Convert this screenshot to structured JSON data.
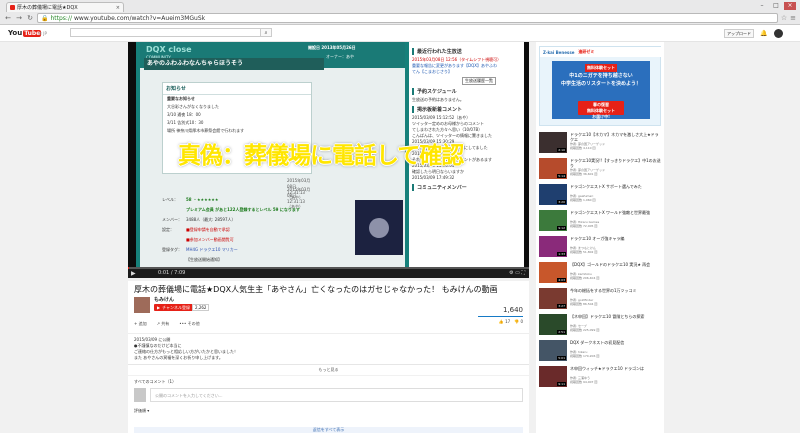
{
  "browser": {
    "tab_title": "厚木の葬儀場に電話★DQX",
    "tab_close": "×",
    "url_scheme": "https://",
    "url_rest": "www.youtube.com/watch?v=Aueim3MGuSk",
    "win_min": "–",
    "win_max": "□",
    "win_close": "×"
  },
  "youtube": {
    "logo_you": "You",
    "logo_tube": "Tube",
    "logo_jp": "JP",
    "upload_label": "アップロード"
  },
  "video": {
    "poster": {
      "brand": "DQX close",
      "brand_sub": "COMMUNITY",
      "date": "開設日 2013年05月26日",
      "owner": "オーナー：あや",
      "header_title": "あやのふわふわなんちゃらほうそう",
      "notice_heading": "お知らせ",
      "notice_title": "重要なお知らせ",
      "notice_lines": [
        "大谷彩さんがなくなりました",
        "3/10  通夜  18：00",
        "3/11  告別式10：30",
        "場所  神奈川県厚木市葬祭会館で行われます"
      ],
      "stamp1": "2015年03月08日 12:31:13（あや）",
      "stamp2": "2015年03月08日 12:31:13（あや）",
      "profile": [
        {
          "k": "レベル：",
          "v": "58 ・★★★★★★",
          "c": "hi"
        },
        {
          "k": "",
          "v": "プレミアム会員 があと122人登録するとレベル 59 になります",
          "c": "hi"
        },
        {
          "k": "メンバー：",
          "v": "3488人（最大: 28597人）",
          "c": ""
        },
        {
          "k": "設定：",
          "v": "■登録申請を自動で承認",
          "c": "red"
        },
        {
          "k": "",
          "v": "■参加メンバー動画閲覧可",
          "c": "red"
        },
        {
          "k": "登録タグ：",
          "v": "MH4G  ドラクエ10  マリカー",
          "c": "blue"
        },
        {
          "k": "",
          "v": "【生放送開始通知】",
          "c": ""
        }
      ],
      "panel": {
        "sec1": "最近行われた生放送",
        "live_date": "2015年03月08日 12:56（タイムシフト視聴可）",
        "live_title": "重要な報告に変更があります【DQX】あやふわ",
        "live_sub": "てん【こまおじさり】",
        "sec1_btn": "生放送履歴一覧",
        "sec2": "予約スケジュール",
        "sec2_text": "生放送の予約はありません。",
        "sec3": "掲示板新着コメント",
        "comments": [
          "2015/03/09 15:12:52（あや）",
          "ツイッター定めのお母様からのコメント",
          "てしまわされた方々へ思い（10/07B）",
          "こんばんは、ツイッターの情報に驚きました",
          "2015/03/09 15:30:29",
          "ごきおにぎりと生放送楽しみにしてました",
          "2015/03/09 15:47:51",
          "それぞれのアカウントでコメントがあるます",
          "2015/03/09 15:56:01",
          "確認したら明日ならいますか",
          "2015/03/09 17:49:32"
        ],
        "sec4": "コミュニティメンバー"
      }
    },
    "overlay": "真偽：葬儀場に電話して確認",
    "time": "0:01 / 7:09",
    "play_icon": "▶",
    "ctl_icons": "⚙  ▭  ⛶",
    "progress": 0.002
  },
  "info": {
    "title": "厚木の葬儀場に電話★DQX人気生主「あやさん」亡くなったのはガセじゃなかった！ もみけんの動画",
    "channel": "もみけん",
    "subscribe": "チャンネル登録",
    "sub_count": "2,262",
    "views": "1,640",
    "actions": [
      "+ 追加",
      "↗ 共有",
      "••• その他"
    ],
    "likes": "👍 17",
    "dislikes": "👎 0",
    "like_ratio": 1.0
  },
  "description": {
    "lines": [
      "2015/03/09 に公開",
      "●不謹慎なのだけど本当に",
      "ご連絡の仕方がもっと相応しい方がいたかと思いました！",
      "また あやさんの冥福を深くお祈り申し上げます。"
    ],
    "more": "もっと見る"
  },
  "comments": {
    "heading": "すべてのコメント（1）",
    "placeholder": "公開のコメントを入力してください...",
    "sort": "評価順 ▾",
    "bottom": "返信をすべて表示"
  },
  "sidebar": {
    "ad_brand": "Z-kai Benesse",
    "ad_brand2": "進研ゼミ",
    "ad_tag": "無料体験セット",
    "ad_main": "中1のニガテを持ち越さない\n中学生活のリスタートを決めよう！",
    "ad_cta": "春の復習\n無料体験セット\nお届け中!",
    "related": [
      {
        "title": "ドラクエ10【ネカマ】ネカマを激しさ大上★ドラクエ",
        "meta": "作者: 夢の国アリーゲッド",
        "meta2": "視聴回数 4,110 回",
        "dur": "2:10",
        "color": "#3b2f2f"
      },
      {
        "title": "ドラクエ10実況!!【すっきりドラクエ】中1のお送り",
        "meta": "作者: 夢の国アリーゲッド",
        "meta2": "視聴回数 36,601 回",
        "dur": "5:14",
        "color": "#b64b2c"
      },
      {
        "title": "ドラゴンクエストX サポート選んでみた",
        "meta": "作者: gaafumari",
        "meta2": "視聴回数 1,060 回",
        "dur": "3:20",
        "color": "#1f3f6f"
      },
      {
        "title": "ドラゴンクエストX ワールド強敵と世界最強",
        "meta": "作者: Hikaru Games",
        "meta2": "視聴回数 72,005 回",
        "dur": "9:12",
        "color": "#3c7a3c"
      },
      {
        "title": "ドラクエ10 オーガ強キャラ編",
        "meta": "作者: まつもとけん",
        "meta2": "視聴回数 51,802 回",
        "dur": "1:33",
        "color": "#8a2a7a"
      },
      {
        "title": "【DQX】ゴールドのドラクエ10 実況★ 再会",
        "meta": "作者: kamitoku",
        "meta2": "視聴回数 206,404 回",
        "dur": "4:03",
        "color": "#c8572b"
      },
      {
        "title": "今年の総括をする世界の1万ツッコミ",
        "meta": "作者: goldfinder",
        "meta2": "視聴回数 86,504 回",
        "dur": "3:27",
        "color": "#7a3a30"
      },
      {
        "title": "【ネ申回】ドラクエ10 冒険とちらの探索",
        "meta": "作者: セーブ",
        "meta2": "視聴回数 225,099 回",
        "dur": "2:51",
        "color": "#2a4a2a"
      },
      {
        "title": "DQX ダークネストの初見配信",
        "meta": "作者: hikaru",
        "meta2": "視聴回数 170,206 回",
        "dur": "5:01",
        "color": "#445566"
      },
      {
        "title": "ネ申回ウィッチ★ドラクエ10 ドラゴンは",
        "meta": "作者: 三浦ゆう",
        "meta2": "視聴回数 94,007 回",
        "dur": "9:11",
        "color": "#6a2a2a"
      }
    ]
  }
}
